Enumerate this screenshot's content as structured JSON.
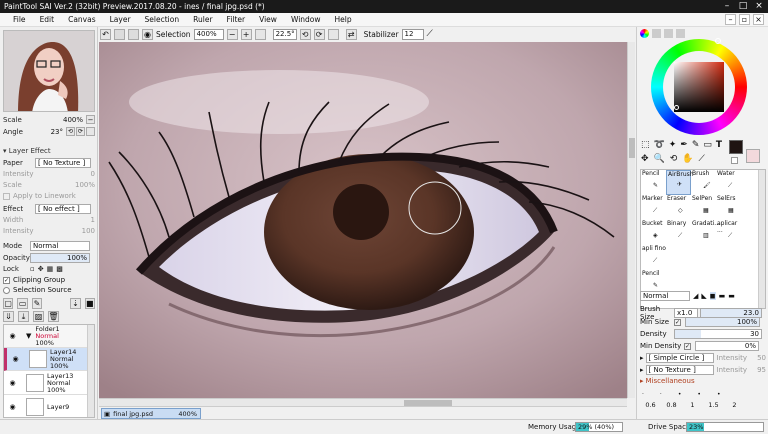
{
  "window": {
    "title": "PaintTool SAI Ver.2 (32bit) Preview.2017.08.20 - ines / final jpg.psd (*)",
    "controls": [
      "minimize-icon",
      "maximize-icon",
      "close-icon"
    ]
  },
  "menu": {
    "items": [
      "File",
      "Edit",
      "Canvas",
      "Layer",
      "Selection",
      "Ruler",
      "Filter",
      "View",
      "Window",
      "Help"
    ]
  },
  "toolbar": {
    "selection_label": "Selection",
    "zoom": "400%",
    "angle": "22.5°",
    "stabilizer_label": "Stabilizer",
    "stabilizer_value": "12"
  },
  "navigator": {
    "scale_label": "Scale",
    "scale_value": "400%",
    "angle_label": "Angle",
    "angle_value": "23°"
  },
  "layer_effect": {
    "header": "Layer Effect",
    "paper_label": "Paper",
    "paper_value": "[ No Texture ]",
    "intensity_label": "Intensity",
    "intensity_value": "0",
    "scale_label": "Scale",
    "scale_value": "100%",
    "apply_linework": "Apply to Linework",
    "effect_label": "Effect",
    "effect_value": "[ No effect ]",
    "width_label": "Width",
    "width_value": "1",
    "intensity2_label": "Intensity",
    "intensity2_value": "100"
  },
  "layer_props": {
    "mode_label": "Mode",
    "mode_value": "Normal",
    "opacity_label": "Opacity",
    "opacity_value": "100%",
    "lock_label": "Lock",
    "clipping_group": "Clipping Group",
    "selection_source": "Selection Source"
  },
  "layers": [
    {
      "name": "Folder1",
      "mode": "Normal",
      "opacity": "100%"
    },
    {
      "name": "Layer14",
      "mode": "Normal",
      "opacity": "100%"
    },
    {
      "name": "Layer13",
      "mode": "Normal",
      "opacity": "100%"
    },
    {
      "name": "Layer9",
      "mode": "",
      "opacity": ""
    }
  ],
  "document": {
    "tab_name": "final jpg.psd",
    "tab_zoom": "400%"
  },
  "tools": {
    "items": [
      "Pencil",
      "AirBrush",
      "Brush",
      "Water",
      "Marker",
      "Eraser",
      "SelPen",
      "SelErs",
      "Bucket",
      "Binary",
      "Gradati...",
      "aplicar ...",
      "apli fino",
      "",
      "",
      "",
      "Pencil",
      "",
      "",
      ""
    ],
    "selected": "AirBrush"
  },
  "brush": {
    "mode_value": "Normal",
    "brush_size_label": "Brush Size",
    "brush_size_mult": "x1.0",
    "brush_size_value": "23.0",
    "min_size_label": "Min Size",
    "min_size_value": "100%",
    "density_label": "Density",
    "density_value": "30",
    "min_density_label": "Min Density",
    "min_density_value": "0%",
    "shape_value": "[ Simple Circle ]",
    "shape_intensity_label": "Intensity",
    "shape_intensity_value": "50",
    "texture_value": "[ No Texture ]",
    "texture_intensity_label": "Intensity",
    "texture_intensity_value": "95",
    "misc_label": "Miscellaneous",
    "sizes": [
      "0.6",
      "0.8",
      "1",
      "1.5",
      "2"
    ]
  },
  "status": {
    "memory_label": "Memory Usage",
    "memory_value": "29% (40%)",
    "memory_fraction": 0.29,
    "drive_label": "Drive Space",
    "drive_value": "23%",
    "drive_fraction": 0.23
  },
  "colors": {
    "primary": "#1f1412",
    "secondary": "#f3d9dc",
    "accent": "#2f6fbf"
  }
}
